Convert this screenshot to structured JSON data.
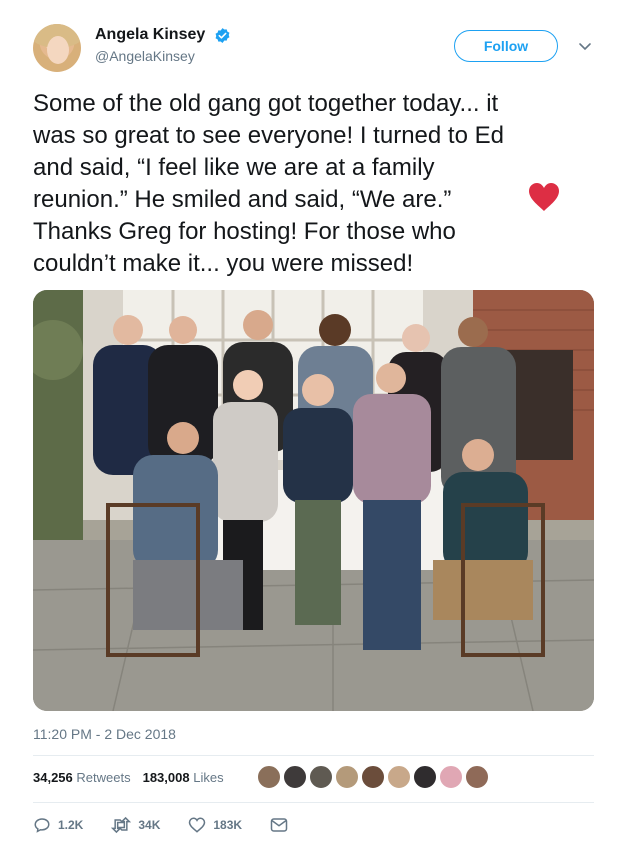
{
  "author": {
    "name": "Angela Kinsey",
    "handle": "@AngelaKinsey",
    "verified": true
  },
  "follow_label": "Follow",
  "tweet": {
    "text": "Some of the old gang got together today... it\nwas so great to see everyone! I turned to Ed\nand said, “I feel like we are at a family\nreunion.” He smiled and said, “We are.” \nThanks Greg for hosting! For those who\ncouldn’t make it... you were missed!",
    "emoji": "red-heart"
  },
  "timestamp": "11:20 PM - 2 Dec 2018",
  "stats": {
    "retweets_count": "34,256",
    "retweets_label": "Retweets",
    "likes_count": "183,008",
    "likes_label": "Likes"
  },
  "actions": {
    "replies": "1.2K",
    "retweets": "34K",
    "likes": "183K"
  },
  "colors": {
    "accent": "#1da1f2",
    "secondary_text": "#657786",
    "heart": "#e0245e"
  }
}
